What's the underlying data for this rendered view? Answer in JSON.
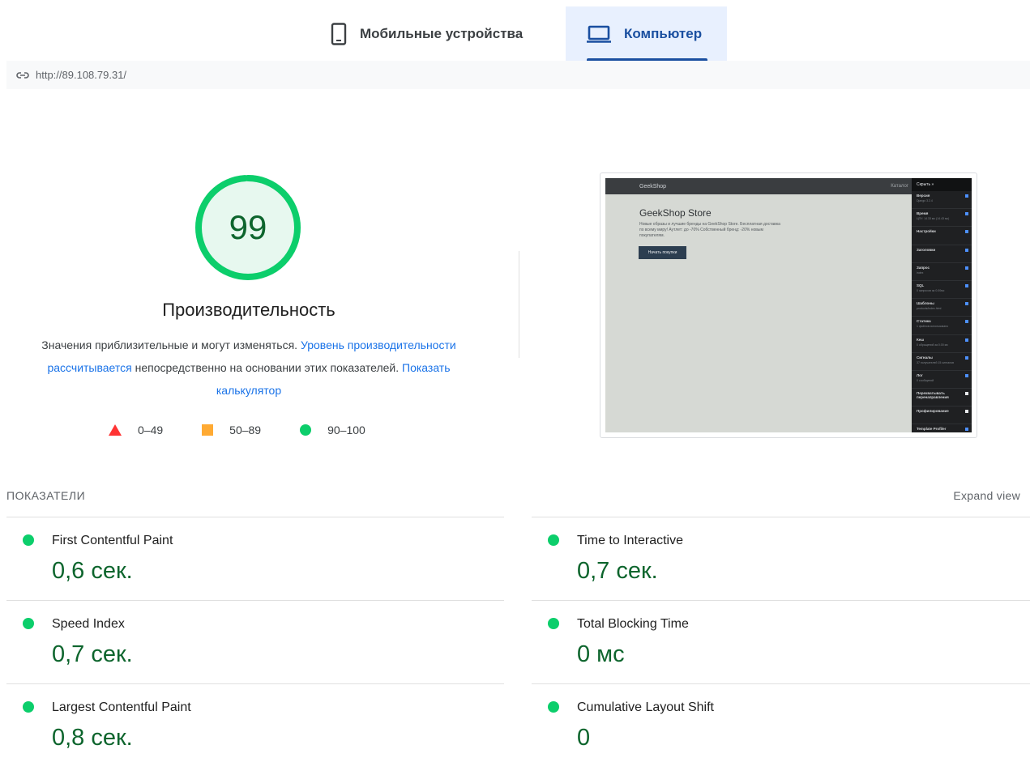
{
  "tabs": [
    {
      "label": "Мобильные устройства",
      "icon": "phone-icon",
      "active": false
    },
    {
      "label": "Компьютер",
      "icon": "laptop-icon",
      "active": true
    }
  ],
  "url": "http://89.108.79.31/",
  "performance": {
    "score": "99",
    "score_fraction": 0.99,
    "title": "Производительность",
    "desc_1": "Значения приблизительные и могут изменяться.",
    "desc_link_1": "Уровень производительности рассчитывается",
    "desc_2": "непосредственно на основании этих показателей.",
    "desc_link_2": "Показать калькулятор",
    "colors": {
      "good": "#0cce6b",
      "average": "#ffaa33",
      "poor": "#ff3333",
      "good_text": "#0d652d",
      "link": "#1a73e8"
    }
  },
  "legend": [
    {
      "range": "0–49",
      "icon": "red-triangle-icon"
    },
    {
      "range": "50–89",
      "icon": "orange-square-icon"
    },
    {
      "range": "90–100",
      "icon": "green-circle-icon"
    }
  ],
  "preview": {
    "brand": "GeekShop",
    "nav_right": "Каталог",
    "heading": "GeekShop Store",
    "text": "Новые образы и лучшие бренды на GeekShop Store. Бесплатная доставка по всему миру! Аутлет: до -70% Собственный бренд: -20% новым покупателям.",
    "button": "Начать покупки",
    "panel_title": "Скрыть »",
    "panel_items": [
      {
        "t": "Версия",
        "s": "Django 3.2.4"
      },
      {
        "t": "Время",
        "s": "ЦПУ: 14.33 мс (14.43 мс)"
      },
      {
        "t": "Настройки",
        "s": ""
      },
      {
        "t": "Заголовки",
        "s": ""
      },
      {
        "t": "Запрос",
        "s": "index"
      },
      {
        "t": "SQL",
        "s": "0 запросов за 0.00мс"
      },
      {
        "t": "Шаблоны",
        "s": "products/index.html"
      },
      {
        "t": "Статика",
        "s": "1 файлов использовано"
      },
      {
        "t": "Кеш",
        "s": "0 обращений за 0.00 мс"
      },
      {
        "t": "Сигналы",
        "s": "37 получателей 15 сигналов"
      },
      {
        "t": "Лог",
        "s": "0 сообщений"
      },
      {
        "t": "Перехватывать перенаправления",
        "s": ""
      },
      {
        "t": "Профилирование",
        "s": ""
      },
      {
        "t": "Template Profiler",
        "s": "1 calls in 3.10 ms"
      }
    ]
  },
  "metrics_label": "ПОКАЗАТЕЛИ",
  "expand_label": "Expand view",
  "metrics": [
    {
      "name": "First Contentful Paint",
      "value": "0,6 сек."
    },
    {
      "name": "Time to Interactive",
      "value": "0,7 сек."
    },
    {
      "name": "Speed Index",
      "value": "0,7 сек."
    },
    {
      "name": "Total Blocking Time",
      "value": "0 мс"
    },
    {
      "name": "Largest Contentful Paint",
      "value": "0,8 сек."
    },
    {
      "name": "Cumulative Layout Shift",
      "value": "0"
    }
  ]
}
